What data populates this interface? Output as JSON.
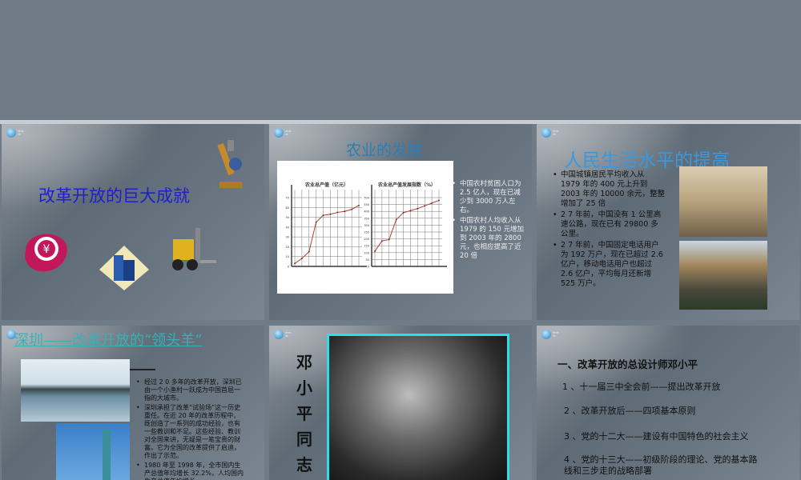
{
  "slides": [
    {
      "title": "改革开放的巨大成就",
      "icons": [
        "microscope-icon",
        "yuan-icon",
        "building-icon",
        "forklift-icon"
      ]
    },
    {
      "title": "农业的发展",
      "bullets": [
        "中国农村贫困人口为 2.5 亿人，现在已减少到 3000 万人左右。",
        "中国农村人均收入从 1979 的 150 元增加到 2003 年的 2800 元，也相应提高了近 20 倍"
      ]
    },
    {
      "title": "人民生活水平的提高",
      "bullets": [
        "中国城镇居民平均收入从 1979 年的 400 元上升到 2003 年的 10000 余元，整整增加了 25 倍",
        "2 7 年前，中国没有 1 公里高速公路，现在已有 29800 多公里。",
        "2 7 年前，中国固定电话用户为 192 万户，现在已超过 2.6 亿户，移动电话用户也超过 2.6 亿户，平均每月还新增 525 万户。"
      ]
    },
    {
      "title": "深圳——改革开放的“领头羊”",
      "bullets": [
        "经过 2 0 多年的改革开放，深圳已由一个小渔村一跃成为中国首屈一指的大城市。",
        "深圳承担了改革“试验场”这一历史重任。在近 20 年的改革历程中，既创造了一系列的成功经验，也有一些教训和不足。这些经验、教训对全国来讲，无疑是一笔宝贵的财富。它为全国的改革提供了启迪，作出了示范。",
        "1980 年至 1998 年，全市国内生产总值年均增长 32.2%，人均国内生产总值年均增长"
      ]
    },
    {
      "vertical_title": "邓小平同志"
    },
    {
      "heading": "一、改革开放的总设计师邓小平",
      "items": [
        "1 、十一届三中全会前——提出改革开放",
        "2 、改革开放后——四项基本原则",
        "3 、党的十二大——建设有中国特色的社会主义",
        "4 、党的十三大——初级阶段的理论、党的基本路线和三步走的战略部署"
      ]
    }
  ],
  "chart_data": [
    {
      "type": "line",
      "title": "农业总产值（亿元）",
      "ylim": [
        0,
        70
      ],
      "yticks": [
        0,
        10,
        20,
        30,
        40,
        50,
        60,
        70
      ],
      "values": [
        3,
        8,
        15,
        45,
        52,
        53,
        55,
        56,
        58,
        62
      ],
      "color": "#c0392b"
    },
    {
      "type": "line",
      "title": "农业总产值发展指数（%）",
      "ylim": [
        0,
        500
      ],
      "yticks": [
        0,
        50,
        100,
        150,
        200,
        250,
        300,
        350,
        400,
        450,
        500
      ],
      "values": [
        110,
        185,
        195,
        340,
        390,
        405,
        420,
        440,
        460,
        480
      ],
      "color": "#c0392b"
    }
  ]
}
